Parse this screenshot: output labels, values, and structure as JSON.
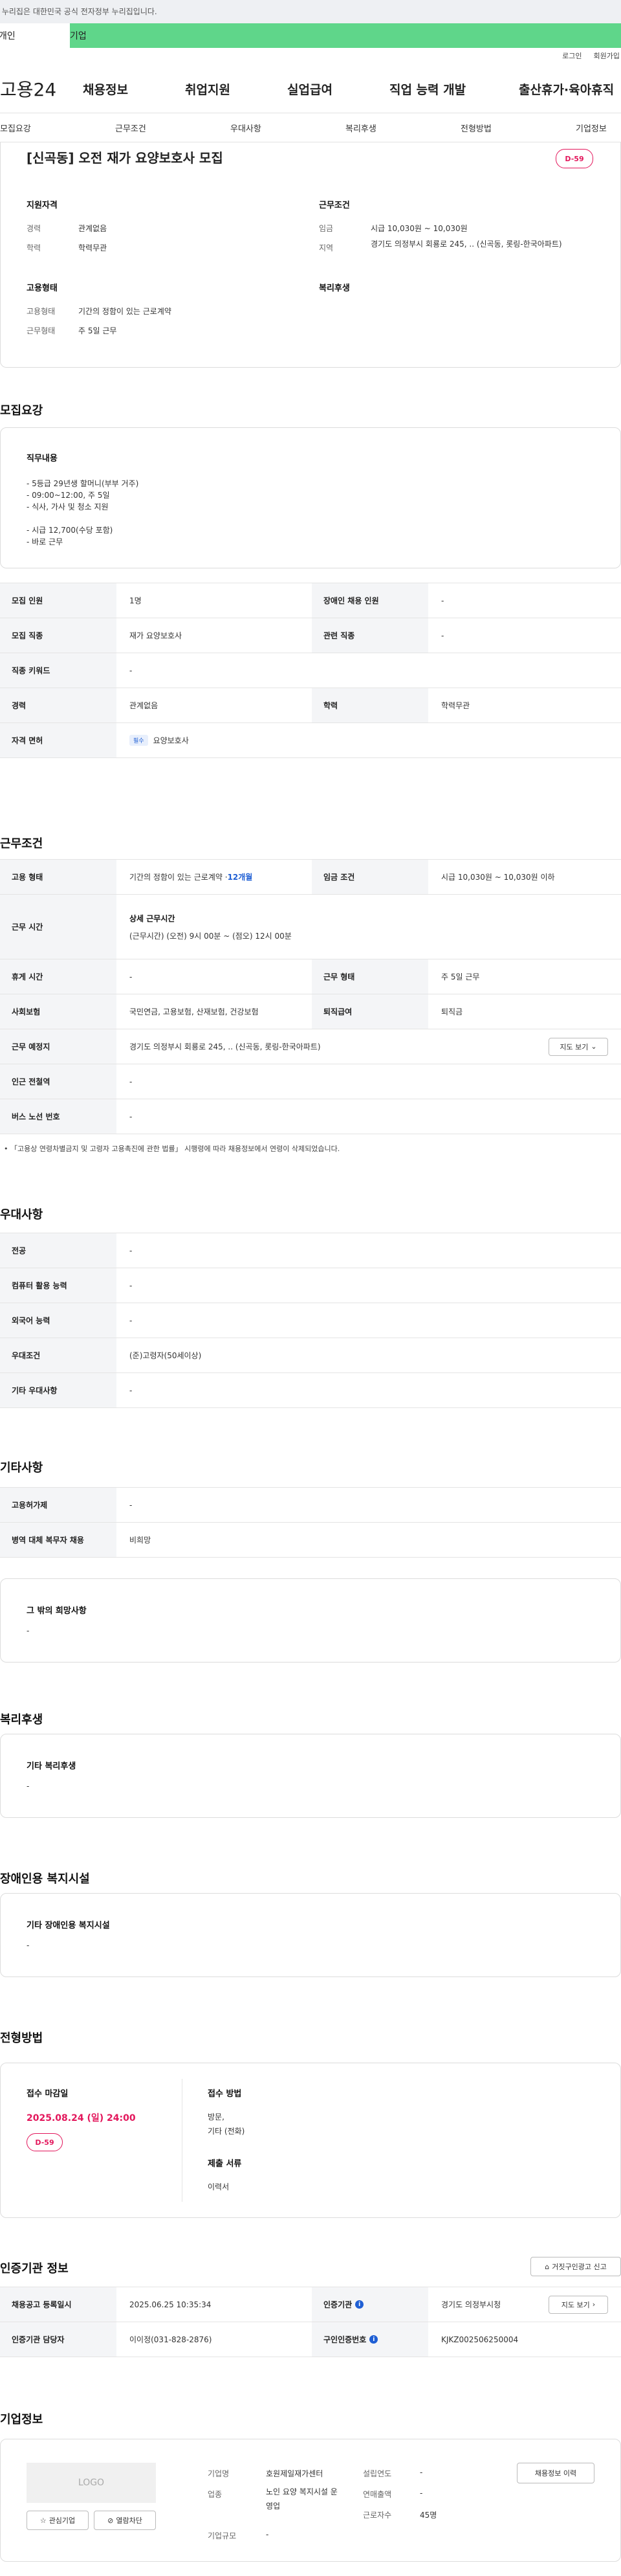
{
  "gov_banner": "이 누리집은 대한민국 공식 전자정부 누리집입니다.",
  "top_tabs": [
    "개인",
    "기업"
  ],
  "util": {
    "login": "로그인",
    "join": "회원가입"
  },
  "logo": "고용24",
  "gnb": [
    "채용정보",
    "취업지원",
    "실업급여",
    "직업 능력 개발",
    "출산휴가·육아휴직"
  ],
  "lnb": [
    "모집요강",
    "근무조건",
    "우대사항",
    "복리후생",
    "전형방법",
    "기업정보"
  ],
  "job": {
    "title": "[신곡동] 오전 재가 요양보호사 모집",
    "dday": "D-59",
    "qual_h": "지원자격",
    "career_l": "경력",
    "career_v": "관계없음",
    "edu_l": "학력",
    "edu_v": "학력무관",
    "work_h": "근무조건",
    "wage_l": "임금",
    "wage_v": "시급 10,030원 ~ 10,030원",
    "loc_l": "지역",
    "loc_v": "경기도 의정부시 회룡로 245, .. (신곡동, 롯링-한국아파트)",
    "emp_h": "고용형태",
    "type_l": "고용형태",
    "type_v": "기간의 정함이 있는 근로계약",
    "form_l": "근무형태",
    "form_v": "주 5일 근무",
    "welfare_h": "복리후생"
  },
  "recruit": {
    "title": "모집요강",
    "duty_h": "직무내용",
    "duty_lines": [
      "- 5등급 29년생 할머니(부부 거주)",
      "- 09:00~12:00, 주 5일",
      "- 식사, 가사 및 청소 지원",
      "",
      "- 시급 12,700(수당 포함)",
      "- 바로 근무"
    ],
    "rows": [
      {
        "l1": "모집 인원",
        "v1": "1명",
        "l2": "장애인 채용 인원",
        "v2": "-"
      },
      {
        "l1": "모집 직종",
        "v1": "재가 요양보호사",
        "l2": "관련 직종",
        "v2": "-"
      },
      {
        "l1": "직종 키워드",
        "v1": "-"
      },
      {
        "l1": "경력",
        "v1": "관계없음",
        "l2": "학력",
        "v2": "학력무관"
      },
      {
        "l1": "자격 면허",
        "badge": "필수",
        "v1": "요양보호사"
      }
    ]
  },
  "conditions": {
    "title": "근무조건",
    "type_l": "고용 형태",
    "type_v": "기간의 정함이 있는 근로계약 · ",
    "type_month": "12개월",
    "wage_l": "임금 조건",
    "wage_v": "시급 10,030원 ~ 10,030원 이하",
    "time_l": "근무 시간",
    "time_h": "상세 근무시간",
    "time_v": "(근무시간) (오전) 9시 00분 ~ (점오) 12시 00분",
    "rest_l": "휴게 시간",
    "rest_v": "-",
    "form_l": "근무 형태",
    "form_v": "주 5일 근무",
    "ins_l": "사회보험",
    "ins_v": "국민연금, 고용보험, 산재보험, 건강보험",
    "ret_l": "퇴직급여",
    "ret_v": "퇴직금",
    "place_l": "근무 예정지",
    "place_v": "경기도 의정부시 회룡로 245, .. (신곡동, 롯링-한국아파트)",
    "map_btn": "지도 보기",
    "sub_l": "인근 전철역",
    "sub_v": "-",
    "bus_l": "버스 노선 번호",
    "bus_v": "-",
    "note": "「고용상 연령차별금지 및 고령자 고용촉진에 관한 법률」 시행령에 따라 채용정보에서 연령이 삭제되었습니다."
  },
  "prefer": {
    "title": "우대사항",
    "rows": [
      {
        "l": "전공",
        "v": "-"
      },
      {
        "l": "컴퓨터 활용 능력",
        "v": "-"
      },
      {
        "l": "외국어 능력",
        "v": "-"
      },
      {
        "l": "우대조건",
        "v": "(준)고령자(50세이상)"
      },
      {
        "l": "기타 우대사항",
        "v": "-"
      }
    ]
  },
  "etc": {
    "title": "기타사항",
    "rows": [
      {
        "l": "고용허가제",
        "v": "-"
      },
      {
        "l": "병역 대체 복무자 채용",
        "v": "비희망"
      }
    ],
    "hope_h": "그 밖의 희망사항",
    "hope_v": "-"
  },
  "welfare": {
    "title": "복리후생",
    "h": "기타 복리후생",
    "v": "-"
  },
  "disabled": {
    "title": "장애인용 복지시설",
    "h": "기타 장애인용 복지시설",
    "v": "-"
  },
  "selection": {
    "title": "전형방법",
    "deadline_h": "접수 마감일",
    "deadline_v": "2025.08.24 (일) 24:00",
    "dday": "D-59",
    "method_h": "접수 방법",
    "method_v1": "방문,",
    "method_v2": "기타 (전화)",
    "docs_h": "제출 서류",
    "docs_v": "이력서"
  },
  "cert": {
    "title": "인증기관 정보",
    "report_btn": "거짓구인광고 신고",
    "rows": [
      {
        "l1": "채용공고 등록일시",
        "v1": "2025.06.25 10:35:34",
        "l2": "인증기관",
        "v2": "경기도 의정부시청",
        "btn": "지도 보기"
      },
      {
        "l1": "인증기관 담당자",
        "v1": "이이정(031-828-2876)",
        "l2": "구인인증번호",
        "v2": "KJKZ002506250004"
      }
    ]
  },
  "company": {
    "title": "기업정보",
    "logo": "LOGO",
    "fav_btn": "관심기업",
    "block_btn": "열람차단",
    "name_l": "기업명",
    "name_v": "호원제일재가센터",
    "ind_l": "업종",
    "ind_v": "노인 요양 복지시설 운영업",
    "size_l": "기업규모",
    "size_v": "-",
    "year_l": "설립연도",
    "year_v": "-",
    "sales_l": "연매출액",
    "sales_v": "-",
    "emp_l": "근로자수",
    "emp_v": "45명",
    "jobs_btn": "채용정보 이력"
  },
  "colors": {
    "accent": "#5fd68a",
    "dday": "#e3175c",
    "link": "#1f5fd4"
  }
}
